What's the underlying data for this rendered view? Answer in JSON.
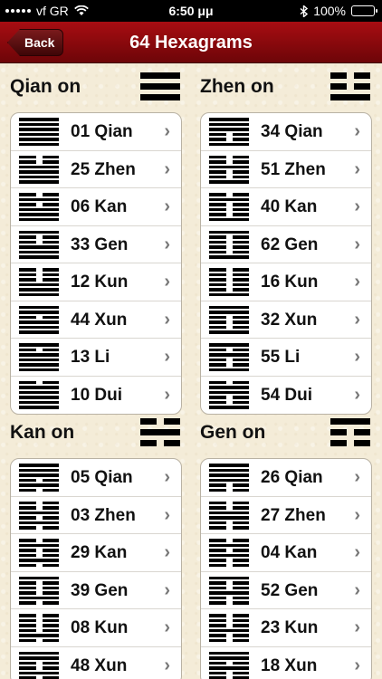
{
  "status": {
    "carrier": "vf GR",
    "time": "6:50 μμ",
    "battery": "100%",
    "battery_level": 1.0
  },
  "nav": {
    "back_label": "Back",
    "title": "64 Hexagrams"
  },
  "sections": [
    {
      "title": "Qian on",
      "icon": "hexagram-qian-icon",
      "lines": [
        1,
        1,
        1
      ],
      "items": [
        {
          "label": "01 Qian",
          "lines": [
            1,
            1,
            1,
            1,
            1,
            1
          ]
        },
        {
          "label": "25 Zhen",
          "lines": [
            0,
            0,
            1,
            1,
            1,
            1
          ]
        },
        {
          "label": "06 Kan",
          "lines": [
            0,
            1,
            0,
            1,
            1,
            1
          ]
        },
        {
          "label": "33 Gen",
          "lines": [
            1,
            0,
            0,
            1,
            1,
            1
          ]
        },
        {
          "label": "12 Kun",
          "lines": [
            0,
            0,
            0,
            1,
            1,
            1
          ]
        },
        {
          "label": "44 Xun",
          "lines": [
            1,
            1,
            0,
            1,
            1,
            1
          ]
        },
        {
          "label": "13 Li",
          "lines": [
            1,
            0,
            1,
            1,
            1,
            1
          ]
        },
        {
          "label": "10 Dui",
          "lines": [
            0,
            1,
            1,
            1,
            1,
            1
          ]
        }
      ]
    },
    {
      "title": "Zhen on",
      "icon": "hexagram-zhen-icon",
      "lines": [
        0,
        0,
        1
      ],
      "items": [
        {
          "label": "34 Qian",
          "lines": [
            1,
            1,
            1,
            0,
            0,
            1
          ]
        },
        {
          "label": "51 Zhen",
          "lines": [
            0,
            0,
            1,
            0,
            0,
            1
          ]
        },
        {
          "label": "40 Kan",
          "lines": [
            0,
            1,
            0,
            0,
            0,
            1
          ]
        },
        {
          "label": "62 Gen",
          "lines": [
            1,
            0,
            0,
            0,
            0,
            1
          ]
        },
        {
          "label": "16 Kun",
          "lines": [
            0,
            0,
            0,
            0,
            0,
            1
          ]
        },
        {
          "label": "32 Xun",
          "lines": [
            1,
            1,
            0,
            0,
            0,
            1
          ]
        },
        {
          "label": "55 Li",
          "lines": [
            1,
            0,
            1,
            0,
            0,
            1
          ]
        },
        {
          "label": "54 Dui",
          "lines": [
            0,
            1,
            1,
            0,
            0,
            1
          ]
        }
      ]
    },
    {
      "title": "Kan on",
      "icon": "hexagram-kan-icon",
      "lines": [
        0,
        1,
        0
      ],
      "items": [
        {
          "label": "05 Qian",
          "lines": [
            1,
            1,
            1,
            0,
            1,
            0
          ]
        },
        {
          "label": "03 Zhen",
          "lines": [
            0,
            0,
            1,
            0,
            1,
            0
          ]
        },
        {
          "label": "29 Kan",
          "lines": [
            0,
            1,
            0,
            0,
            1,
            0
          ]
        },
        {
          "label": "39 Gen",
          "lines": [
            1,
            0,
            0,
            0,
            1,
            0
          ]
        },
        {
          "label": "08 Kun",
          "lines": [
            0,
            0,
            0,
            0,
            1,
            0
          ]
        },
        {
          "label": "48 Xun",
          "lines": [
            1,
            1,
            0,
            0,
            1,
            0
          ]
        }
      ]
    },
    {
      "title": "Gen on",
      "icon": "hexagram-gen-icon",
      "lines": [
        1,
        0,
        0
      ],
      "items": [
        {
          "label": "26 Qian",
          "lines": [
            1,
            1,
            1,
            1,
            0,
            0
          ]
        },
        {
          "label": "27 Zhen",
          "lines": [
            0,
            0,
            1,
            1,
            0,
            0
          ]
        },
        {
          "label": "04 Kan",
          "lines": [
            0,
            1,
            0,
            1,
            0,
            0
          ]
        },
        {
          "label": "52 Gen",
          "lines": [
            1,
            0,
            0,
            1,
            0,
            0
          ]
        },
        {
          "label": "23 Kun",
          "lines": [
            0,
            0,
            0,
            1,
            0,
            0
          ]
        },
        {
          "label": "18 Xun",
          "lines": [
            1,
            1,
            0,
            1,
            0,
            0
          ]
        }
      ]
    }
  ]
}
